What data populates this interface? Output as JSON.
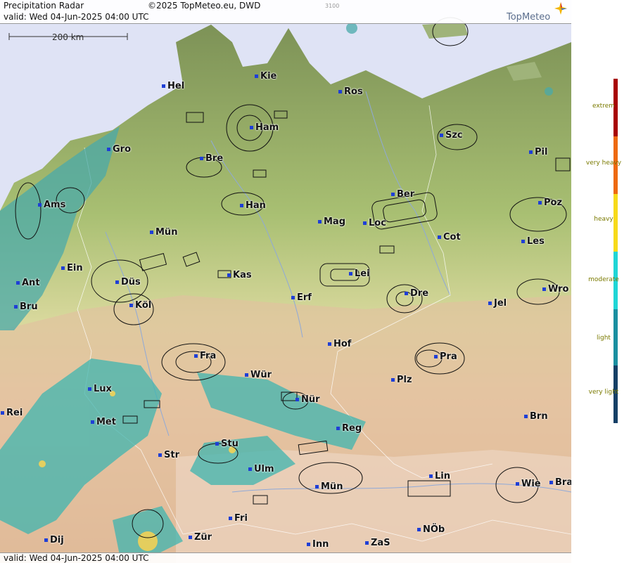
{
  "header": {
    "title": "Precipitation Radar",
    "copyright": "©2025 TopMeteo.eu, DWD",
    "code": "3100",
    "valid": "valid:  Wed  04-Jun-2025 04:00 UTC"
  },
  "footer": {
    "valid": "valid:  Wed  04-Jun-2025 04:00 UTC"
  },
  "logo": {
    "text": "TopMeteo"
  },
  "scale": {
    "label": "200 km"
  },
  "cities": [
    {
      "name": "Hel"
    },
    {
      "name": "Kie"
    },
    {
      "name": "Ros"
    },
    {
      "name": "Ham"
    },
    {
      "name": "Szc"
    },
    {
      "name": "Gro"
    },
    {
      "name": "Bre"
    },
    {
      "name": "Pil"
    },
    {
      "name": "Ams"
    },
    {
      "name": "Han"
    },
    {
      "name": "Ber"
    },
    {
      "name": "Poz"
    },
    {
      "name": "Mün"
    },
    {
      "name": "Mag"
    },
    {
      "name": "Loc"
    },
    {
      "name": "Cot"
    },
    {
      "name": "Les"
    },
    {
      "name": "Ein"
    },
    {
      "name": "Kas"
    },
    {
      "name": "Lei"
    },
    {
      "name": "Ant"
    },
    {
      "name": "Düs"
    },
    {
      "name": "Dre"
    },
    {
      "name": "Wro"
    },
    {
      "name": "Bru"
    },
    {
      "name": "Köl"
    },
    {
      "name": "Erf"
    },
    {
      "name": "Jel"
    },
    {
      "name": "Hof"
    },
    {
      "name": "Fra"
    },
    {
      "name": "Pra"
    },
    {
      "name": "Wür"
    },
    {
      "name": "Plz"
    },
    {
      "name": "Lux"
    },
    {
      "name": "Nür"
    },
    {
      "name": "Rei"
    },
    {
      "name": "Met"
    },
    {
      "name": "Reg"
    },
    {
      "name": "Brn"
    },
    {
      "name": "Stu"
    },
    {
      "name": "Str"
    },
    {
      "name": "Ulm"
    },
    {
      "name": "Lin"
    },
    {
      "name": "Mün"
    },
    {
      "name": "Wie"
    },
    {
      "name": "Bra"
    },
    {
      "name": "Fri"
    },
    {
      "name": "NÖb"
    },
    {
      "name": "Dij"
    },
    {
      "name": "Zür"
    },
    {
      "name": "Inn"
    },
    {
      "name": "ZaS"
    }
  ],
  "legend": {
    "levels": [
      {
        "label": "extrem",
        "color": "#a80000"
      },
      {
        "label": "very heavy",
        "color": "#ee6a10"
      },
      {
        "label": "heavy",
        "color": "#f7da1a"
      },
      {
        "label": "moderate",
        "color": "#1fd6d6"
      },
      {
        "label": "light",
        "color": "#1a8fa0"
      },
      {
        "label": "very light",
        "color": "#153f66"
      }
    ]
  }
}
